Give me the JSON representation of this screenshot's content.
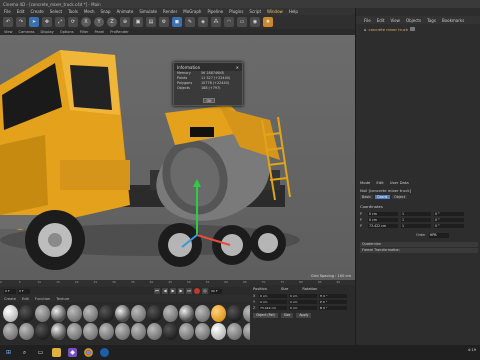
{
  "window": {
    "title": "Cinema 4D - [concrete_mixer_truck.c4d *] - Main"
  },
  "menu": [
    "File",
    "Edit",
    "Create",
    "Select",
    "Tools",
    "Mesh",
    "Snap",
    "Animate",
    "Simulate",
    "Tracker",
    "Render",
    "Sculpt",
    "Motion Tracker",
    "MoGraph",
    "Character",
    "Pipeline",
    "Plugins",
    "Script",
    "Window",
    "Help"
  ],
  "viewport_menu": [
    "View",
    "Cameras",
    "Display",
    "Options",
    "Filter",
    "Panel",
    "ProRender"
  ],
  "viewport": {
    "status": "Grid Spacing : 100 cm"
  },
  "info_dialog": {
    "title": "Information",
    "rows": [
      {
        "label": "Memory",
        "value": "56 288746KB"
      },
      {
        "label": "Points",
        "value": "11 327 (+22440)"
      },
      {
        "label": "Polygons",
        "value": "10778 (+22440)"
      },
      {
        "label": "Objects",
        "value": "188 (+797)"
      }
    ],
    "ok_label": "OK"
  },
  "objects_panel": {
    "tabs": [
      "File",
      "Edit",
      "View",
      "Objects",
      "Tags",
      "Bookmarks"
    ],
    "object_name": "concrete mixer truck"
  },
  "attributes": {
    "tabs": [
      "Mode",
      "Edit",
      "User Data"
    ],
    "title": "Null [concrete mixer truck]",
    "subtabs": [
      "Basic",
      "Coord.",
      "Object"
    ],
    "active_subtab": "Coord.",
    "coordinates_label": "Coordinates",
    "rows": [
      {
        "axis": "P",
        "vals": [
          "0 cm",
          "1",
          "0 °"
        ]
      },
      {
        "axis": "P",
        "vals": [
          "0 cm",
          "1",
          "0 °"
        ]
      },
      {
        "axis": "P",
        "vals": [
          "73.422 cm",
          "1",
          "0 °"
        ]
      }
    ],
    "order_label": "Order",
    "order_value": "HPB",
    "sections": [
      "Quaternion",
      "Freeze Transformation"
    ]
  },
  "timeline": {
    "ticks": [
      "0",
      "5",
      "10",
      "15",
      "20",
      "25",
      "30",
      "35",
      "40",
      "45",
      "50",
      "55",
      "60",
      "65",
      "70",
      "75",
      "80",
      "85",
      "90"
    ],
    "start": "0 F",
    "end": "90 F",
    "current": "0 F"
  },
  "materials": {
    "menu": [
      "Create",
      "Edit",
      "Function",
      "Texture"
    ],
    "swatches": [
      "white",
      "black",
      "grey",
      "chrome",
      "grey",
      "grey",
      "black",
      "chrome",
      "grey",
      "black",
      "grey",
      "chrome",
      "grey",
      "orange",
      "black",
      "grey",
      "grey",
      "grey",
      "black",
      "chrome",
      "grey",
      "grey",
      "grey",
      "grey",
      "grey",
      "grey",
      "black",
      "grey",
      "grey",
      "white",
      "grey",
      "grey"
    ]
  },
  "psr": {
    "head": [
      "Position",
      "Size",
      "Rotation"
    ],
    "rows": [
      {
        "axis": "X",
        "vals": [
          "0 cm",
          "0 cm",
          "H 0 °"
        ]
      },
      {
        "axis": "Y",
        "vals": [
          "0 cm",
          "0 cm",
          "P 0 °"
        ]
      },
      {
        "axis": "Z",
        "vals": [
          "73.422 cm",
          "0 cm",
          "B 0 °"
        ]
      }
    ],
    "mode": "Object (Rel)",
    "size_mode": "Size",
    "apply": "Apply"
  },
  "taskbar": {
    "time": "4:19"
  }
}
